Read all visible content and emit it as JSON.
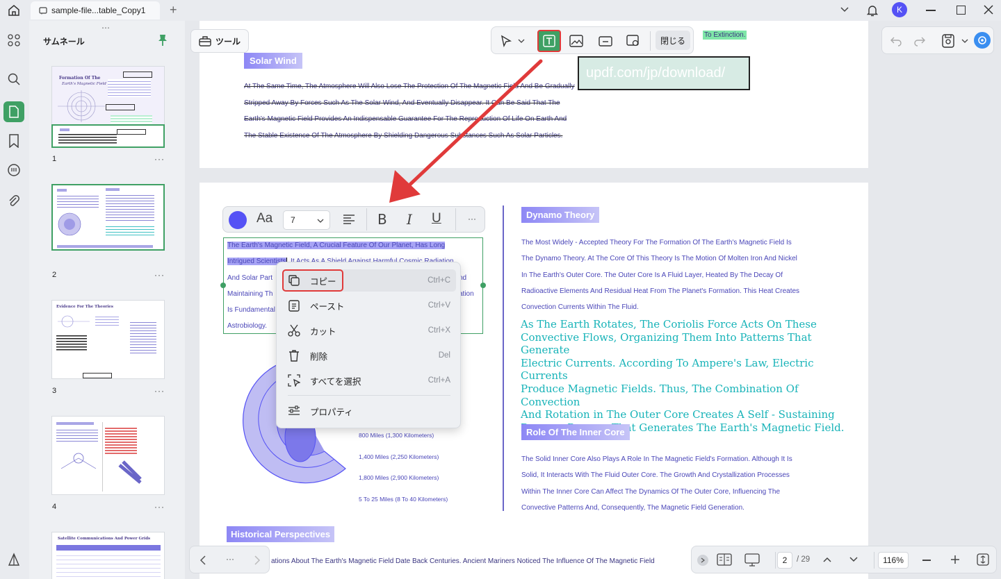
{
  "titlebar": {
    "tab_title": "sample-file...table_Copy1",
    "new_tab": "+",
    "avatar_letter": "K"
  },
  "thumbs": {
    "title": "サムネール",
    "pages": [
      "1",
      "2",
      "3",
      "4"
    ],
    "more": "···",
    "p1_title_a": "Formation Of The",
    "p1_title_b": "Earth's Magnetic Field",
    "p3_title": "Evidence For The Theories",
    "p5_title": "Satellite Communications And Power Grids"
  },
  "toolbar": {
    "tools_label": "ツール",
    "close_label": "閉じる"
  },
  "page1": {
    "top_fragment": "To Extinction.",
    "solar_heading": "Solar Wind",
    "solar_lines": [
      "At The Same Time, The Atmosphere Will Also Lose The Protection Of The Magnetic Field And Be Gradually",
      "Stripped Away By Forces Such As The Solar Wind, And Eventually Disappear. It Can Be Said That The",
      "Earth's Magnetic Field Provides An Indispensable Guarantee For The Reproduction Of Life On Earth And",
      "The Stable Existence Of The Atmosphere By Shielding Dangerous Substances Such As Solar Particles."
    ],
    "watermark": "updf.com/jp/download/"
  },
  "page2": {
    "textbox_lines": [
      "The Earth's Magnetic Field, A Crucial Feature Of Our Planet, Has Long",
      "Intrigued Scientists. It Acts As A Shield Against Harmful Cosmic Radiation",
      "And Solar Particles",
      "Maintaining The",
      "Is Fundamental",
      "Astrobiology."
    ],
    "tb_sel1": "The Earth's Magnetic Field, A Crucial Feature Of Our Planet, Has Long",
    "tb_sel2": "Intrigued Scientists",
    "tb_rest2": ". It Acts As A Shield Against Harmful Cosmic Radiation",
    "tb_l3": "And Solar Part",
    "tb_l3r": "nd",
    "tb_l4": "Maintaining Th",
    "tb_l4r": "ation",
    "tb_l5": "Is Fundamental",
    "tb_l6": "Astrobiology.",
    "core_labels": [
      "800 Miles (1,300 Kilometers)",
      "1,400 Miles (2,250 Kilometers)",
      "1,800 Miles (2,900 Kilometers)",
      "5 To 25 Miles (8 To 40 Kilometers)"
    ],
    "dynamo_heading": "Dynamo Theory",
    "dynamo_lines": [
      "The Most Widely - Accepted Theory For The Formation Of The Earth's Magnetic Field Is",
      "The Dynamo Theory. At The Core Of This Theory Is The Motion Of Molten Iron And Nickel",
      "In The Earth's Outer Core. The Outer Core Is A Fluid Layer, Heated By The Decay Of",
      "Radioactive Elements And Residual Heat From The Planet's Formation. This Heat Creates",
      "Convection Currents Within The Fluid."
    ],
    "serif_lines": [
      "As The Earth Rotates, The Coriolis Force Acts On These",
      "Convective Flows, Organizing Them Into Patterns That Generate",
      "Electric Currents. According To Ampere's Law, Electric Currents",
      "Produce Magnetic Fields. Thus, The Combination Of Convection",
      "And Rotation in The Outer Core Creates A Self - Sustaining",
      "Dynamo Process That Generates The Earth's Magnetic Field."
    ],
    "inner_heading": "Role Of The Inner Core",
    "inner_lines": [
      "The Solid Inner Core Also Plays A Role In The Magnetic Field's Formation. Although It Is",
      "Solid, It Interacts With The Fluid Outer Core. The Growth And Crystallization Processes",
      "Within The Inner Core Can Affect The Dynamics Of The Outer Core, Influencing The",
      "Convective Patterns And, Consequently, The Magnetic Field Generation."
    ],
    "hist_heading": "Historical Perspectives",
    "hist_line": "ations About The Earth's Magnetic Field Date Back Centuries. Ancient Mariners Noticed The Influence Of The Magnetic Field"
  },
  "format": {
    "font_size": "7",
    "font_icon": "Aa",
    "bold": "B",
    "italic": "I",
    "underline": "U",
    "more": "···",
    "color": "#5552f5"
  },
  "context_menu": [
    {
      "label": "コピー",
      "shortcut": "Ctrl+C"
    },
    {
      "label": "ペースト",
      "shortcut": "Ctrl+V"
    },
    {
      "label": "カット",
      "shortcut": "Ctrl+X"
    },
    {
      "label": "削除",
      "shortcut": "Del"
    },
    {
      "label": "すべてを選択",
      "shortcut": "Ctrl+A"
    },
    {
      "label": "プロパティ",
      "shortcut": ""
    }
  ],
  "nav": {
    "current_page": "2",
    "total_pages": "/ 29",
    "zoom": "116%",
    "dots": "···"
  },
  "colors": {
    "accent": "#5552f5",
    "green": "#3fa064",
    "red_highlight": "#e03a3a",
    "heading_purple": "#8d87f5",
    "teal_text": "#17b3b8"
  }
}
